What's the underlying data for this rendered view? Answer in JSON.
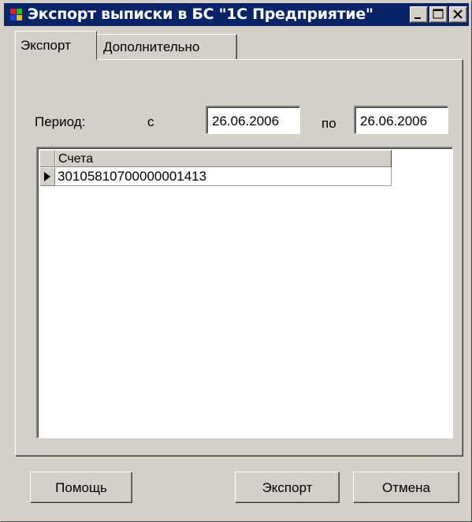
{
  "window": {
    "title": "Экспорт выписки в БС \"1С Предприятие\"",
    "icon": "app-icon",
    "colors": {
      "titlebar": "#0a246a",
      "face": "#d4d0c8"
    }
  },
  "tabs": [
    {
      "label": "Экспорт",
      "active": true
    },
    {
      "label": "Дополнительно",
      "active": false
    }
  ],
  "period": {
    "label": "Период:",
    "from_label": "с",
    "from_value": "26.06.2006",
    "to_label": "по",
    "to_value": "26.06.2006"
  },
  "grid": {
    "column": "Счета",
    "rows": [
      "30105810700000001413"
    ]
  },
  "buttons": {
    "help": "Помощь",
    "export": "Экспорт",
    "cancel": "Отмена"
  }
}
